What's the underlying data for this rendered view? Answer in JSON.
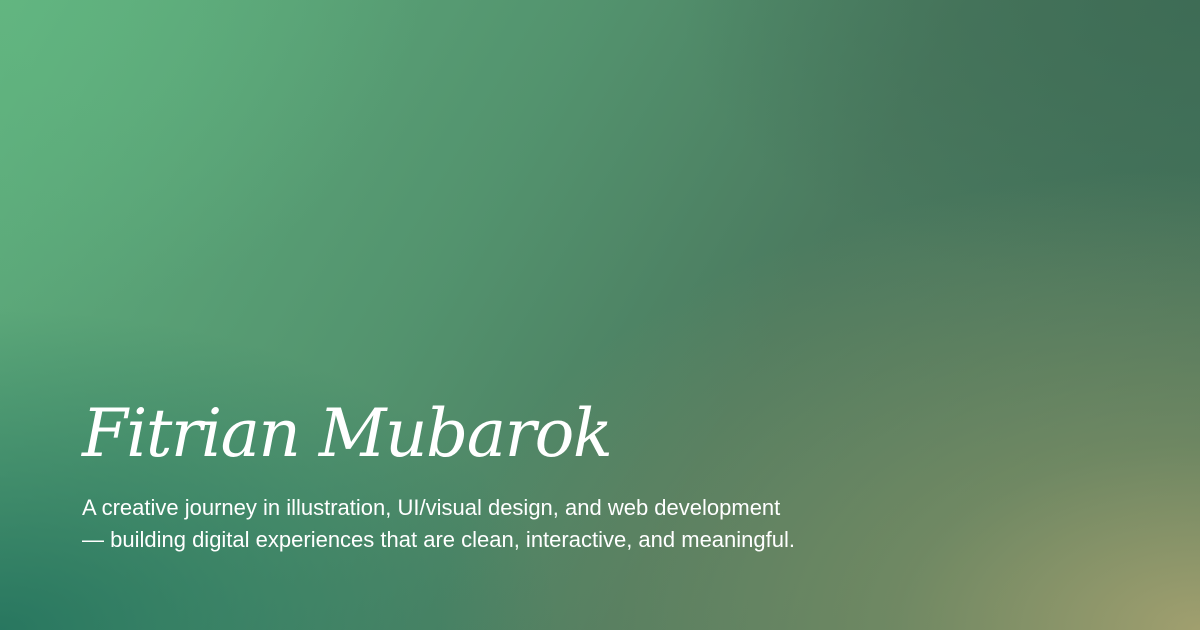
{
  "hero": {
    "title": "Fitrian Mubarok",
    "description_lines": [
      "A creative journey in illustration, UI/visual design, and web development",
      "— building digital experiences that are clean, interactive, and meaningful."
    ]
  },
  "colors": {
    "text": "#ffffff",
    "gradient_top_left": "#5fb07e",
    "gradient_top_right": "#3f6e58",
    "gradient_bottom_left": "#20705c",
    "gradient_bottom_right": "#a6a270"
  }
}
